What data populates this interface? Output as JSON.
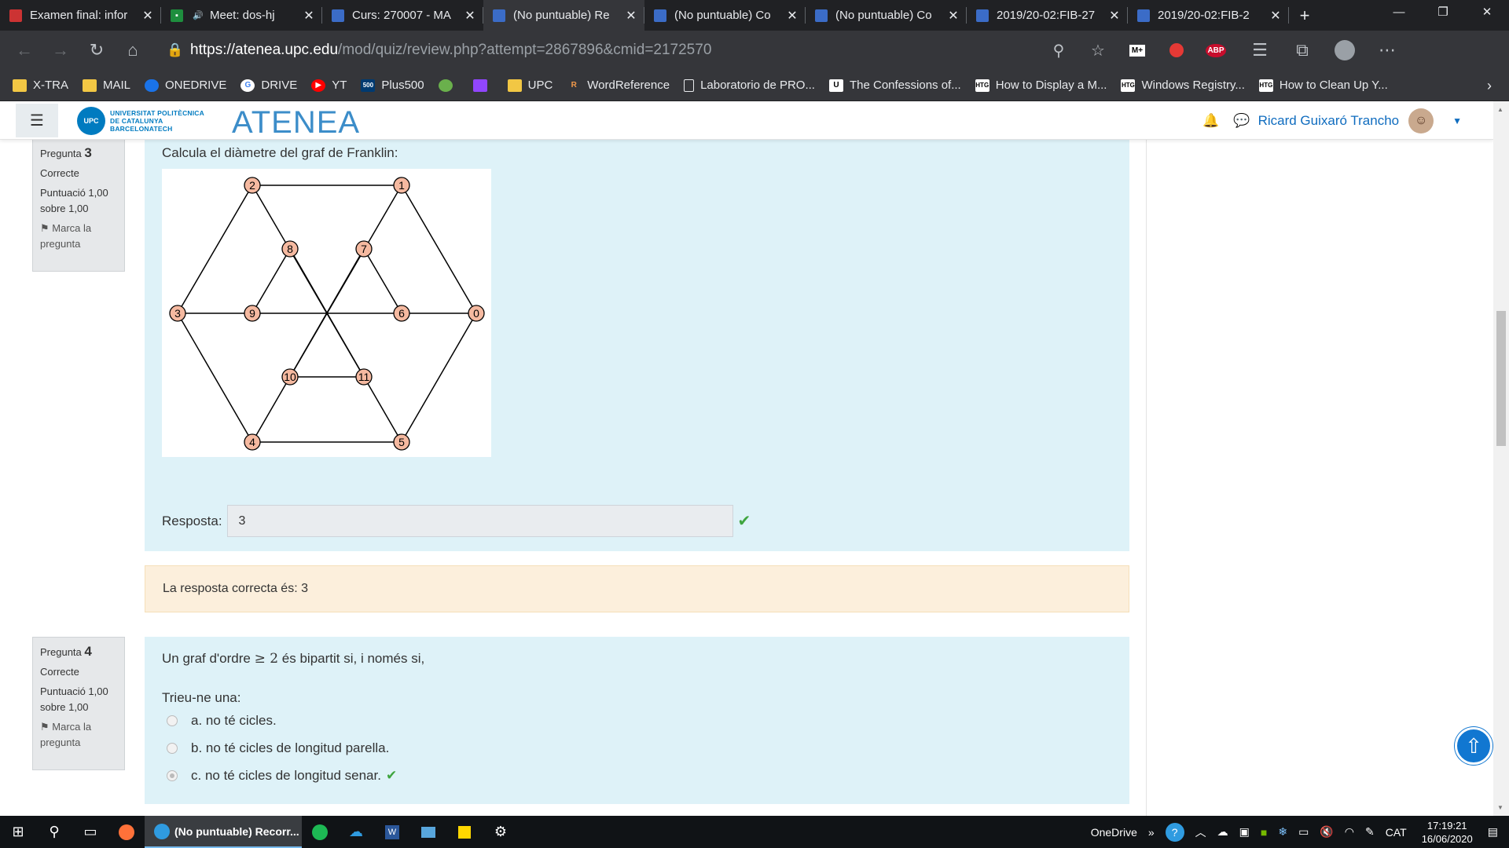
{
  "browser": {
    "tabs": [
      {
        "title": "Examen final: infor",
        "fav": "red-flag"
      },
      {
        "title": "Meet: dos-hj",
        "fav": "meet"
      },
      {
        "title": "Curs: 270007 - MA",
        "fav": "moodle"
      },
      {
        "title": "(No puntuable) Re",
        "fav": "moodle",
        "active": true
      },
      {
        "title": "(No puntuable) Co",
        "fav": "moodle"
      },
      {
        "title": "(No puntuable) Co",
        "fav": "moodle"
      },
      {
        "title": "2019/20-02:FIB-27",
        "fav": "moodle"
      },
      {
        "title": "2019/20-02:FIB-2",
        "fav": "moodle"
      }
    ],
    "url_host": "https://atenea.upc.edu",
    "url_path": "/mod/quiz/review.php?attempt=2867896&cmid=2172570",
    "ext_m": "M+",
    "ext_abp": "ABP",
    "bookmarks": [
      "X-TRA",
      "MAIL",
      "ONEDRIVE",
      "DRIVE",
      "YT",
      "Plus500",
      "",
      "",
      "UPC",
      "WordReference",
      "Laboratorio de PRO...",
      "The Confessions of...",
      "How to Display a M...",
      "Windows Registry...",
      "How to Clean Up Y..."
    ]
  },
  "header": {
    "univ_line1": "UNIVERSITAT POLITÈCNICA",
    "univ_line2": "DE CATALUNYA",
    "univ_line3": "BARCELONATECH",
    "upc_badge": "UPC",
    "site_name": "ATENEA",
    "user_name": "Ricard Guixaró Trancho"
  },
  "q3": {
    "label": "Pregunta",
    "number": "3",
    "state": "Correcte",
    "score": "Puntuació 1,00 sobre 1,00",
    "flag": "Marca la pregunta",
    "text": "Calcula el diàmetre del graf de Franklin:",
    "answer_label": "Resposta:",
    "answer_value": "3",
    "feedback": "La resposta correcta és: 3"
  },
  "graph": {
    "nodes": [
      {
        "id": "0"
      },
      {
        "id": "1"
      },
      {
        "id": "2"
      },
      {
        "id": "3"
      },
      {
        "id": "4"
      },
      {
        "id": "5"
      },
      {
        "id": "6"
      },
      {
        "id": "7"
      },
      {
        "id": "8"
      },
      {
        "id": "9"
      },
      {
        "id": "10"
      },
      {
        "id": "11"
      }
    ],
    "node_fill": "#f5b9a0"
  },
  "q4": {
    "label": "Pregunta",
    "number": "4",
    "state": "Correcte",
    "score": "Puntuació 1,00 sobre 1,00",
    "flag": "Marca la pregunta",
    "text_before": "Un graf d'ordre",
    "text_math": "≥ 2",
    "text_after": "és bipartit si, i només si,",
    "prompt": "Trieu-ne una:",
    "options": [
      {
        "label": "a. no té cicles.",
        "selected": false
      },
      {
        "label": "b. no té cicles de longitud parella.",
        "selected": false
      },
      {
        "label": "c. no té cicles de longitud senar.",
        "selected": true
      }
    ]
  },
  "taskbar": {
    "active_app": "(No puntuable) Recorr...",
    "onedrive": "OneDrive",
    "lang": "CAT",
    "time": "17:19:21",
    "date": "16/06/2020"
  },
  "colors": {
    "accent": "#0f6cbf",
    "question_bg": "#def2f8",
    "feedback_bg": "#fcefdc",
    "correct": "#3fa53f"
  }
}
